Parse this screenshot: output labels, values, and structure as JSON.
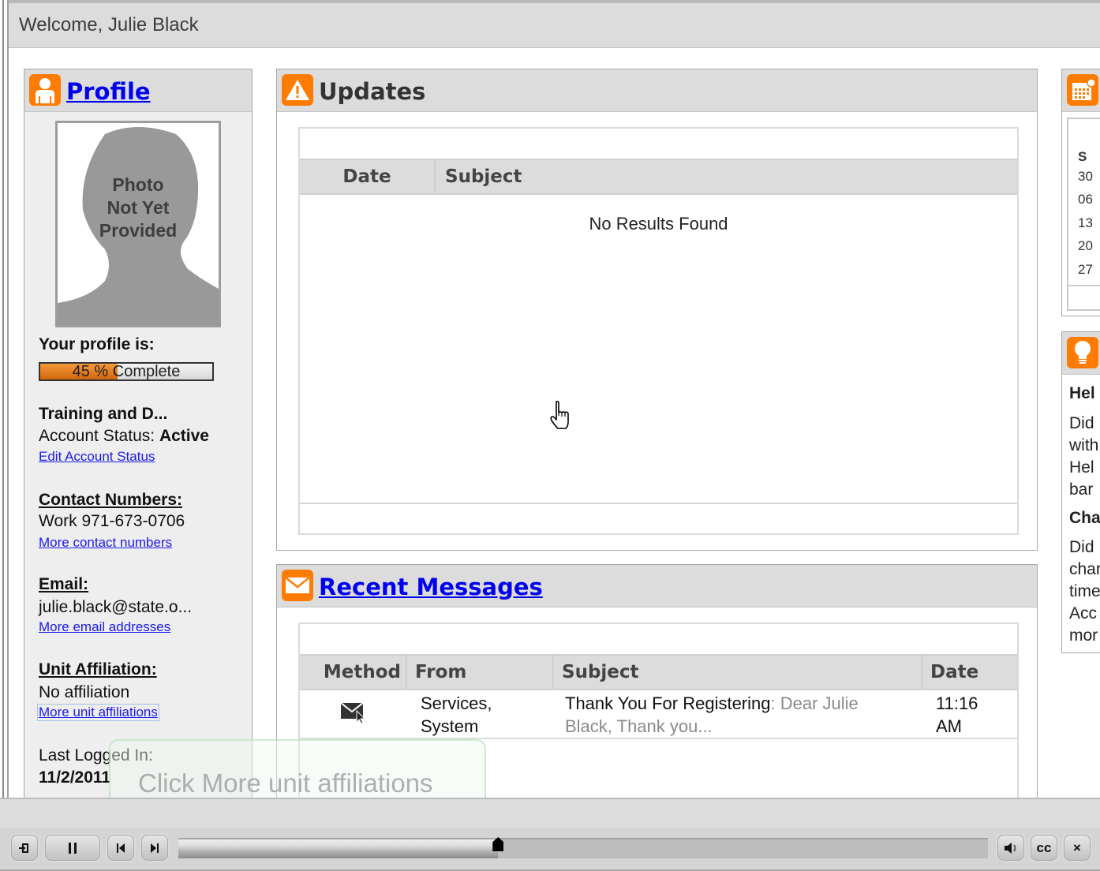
{
  "welcome": "Welcome, Julie Black",
  "profile": {
    "title": "Profile",
    "photo_text": [
      "Photo",
      "Not Yet",
      "Provided"
    ],
    "profile_label": "Your profile is:",
    "completion_percent": 45,
    "completion_label": "45 % Complete",
    "org": "Training and D...",
    "account_status_label": "Account Status:",
    "account_status_value": "Active",
    "edit_account_status": "Edit Account Status",
    "contact_heading": "Contact Numbers:",
    "contact_value": "Work 971-673-0706",
    "more_contacts": "More contact numbers",
    "email_heading": "Email:",
    "email_value": "julie.black@state.o...",
    "more_emails": "More email addresses",
    "unit_heading": "Unit Affiliation:",
    "unit_value": "No affiliation",
    "more_units": "More unit affiliations",
    "last_logged_label": "Last Logged In:",
    "last_logged_value": "11/2/2011"
  },
  "updates": {
    "title": "Updates",
    "columns": [
      "Date",
      "Subject"
    ],
    "empty_text": "No Results Found"
  },
  "messages": {
    "title": "Recent Messages",
    "columns": [
      "Method",
      "From",
      "Subject",
      "Date"
    ],
    "rows": [
      {
        "method_icon": "email-icon",
        "from_line1": "Services,",
        "from_line2": "System",
        "subject_bold": "Thank You For Registering",
        "subject_sep": ":",
        "subject_preview_1": " Dear Julie",
        "subject_preview_2": "Black, Thank you...",
        "date_line1": "11:16",
        "date_line2": "AM"
      }
    ]
  },
  "calendar": {
    "day_header": "S",
    "days": [
      "30",
      "06",
      "13",
      "20",
      "27"
    ]
  },
  "help": {
    "lines": [
      {
        "text": "Hel",
        "bold": true
      },
      {
        "text": "Did",
        "bold": false
      },
      {
        "text": "with",
        "bold": false
      },
      {
        "text": "Hel",
        "bold": false
      },
      {
        "text": "bar",
        "bold": false
      },
      {
        "text": "Cha",
        "bold": true
      },
      {
        "text": "Did",
        "bold": false
      },
      {
        "text": "char",
        "bold": false
      },
      {
        "text": "time",
        "bold": false
      },
      {
        "text": "Acc",
        "bold": false
      },
      {
        "text": "mor",
        "bold": false
      }
    ]
  },
  "tooltip": "Click More unit affiliations",
  "player": {
    "progress_fraction": 0.395,
    "cc_label": "cc",
    "close_label": "×"
  },
  "colors": {
    "accent": "#ff7c00",
    "link": "#0000ee",
    "header_gray": "#dcdcdc"
  }
}
